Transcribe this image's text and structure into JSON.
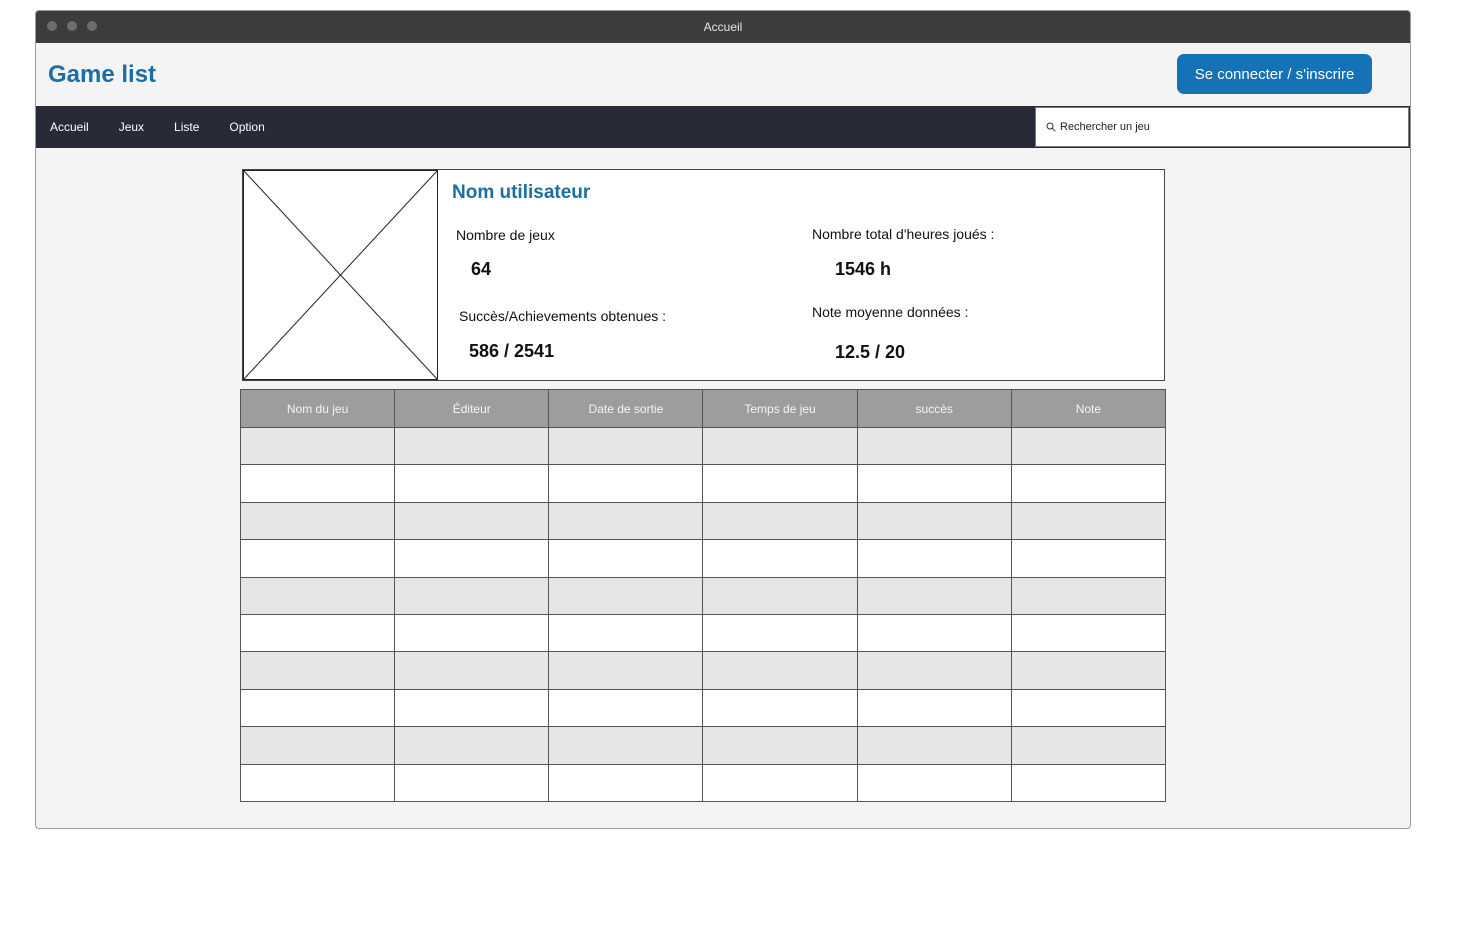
{
  "window": {
    "title": "Accueil"
  },
  "header": {
    "app_title": "Game list",
    "login_label": "Se connecter / s'inscrire"
  },
  "nav": {
    "items": [
      {
        "label": "Accueil"
      },
      {
        "label": "Jeux"
      },
      {
        "label": "Liste"
      },
      {
        "label": "Option"
      }
    ],
    "search_placeholder": "Rechercher un jeu"
  },
  "profile": {
    "username": "Nom utilisateur",
    "games_label": "Nombre de jeux",
    "games_value": "64",
    "hours_label": "Nombre total d'heures joués :",
    "hours_value": "1546 h",
    "achievements_label": "Succès/Achievements obtenues :",
    "achievements_value": "586 / 2541",
    "rating_label": "Note moyenne données :",
    "rating_value": "12.5 / 20"
  },
  "table": {
    "columns": [
      "Nom du jeu",
      "Éditeur",
      "Date de sortie",
      "Temps de jeu",
      "succès",
      "Note"
    ],
    "row_count": 10
  },
  "colors": {
    "accent": "#1c6ea4",
    "button": "#1572b6",
    "navbar": "#282b37",
    "header_row": "#9d9d9d",
    "shaded_row": "#e6e6e6"
  }
}
